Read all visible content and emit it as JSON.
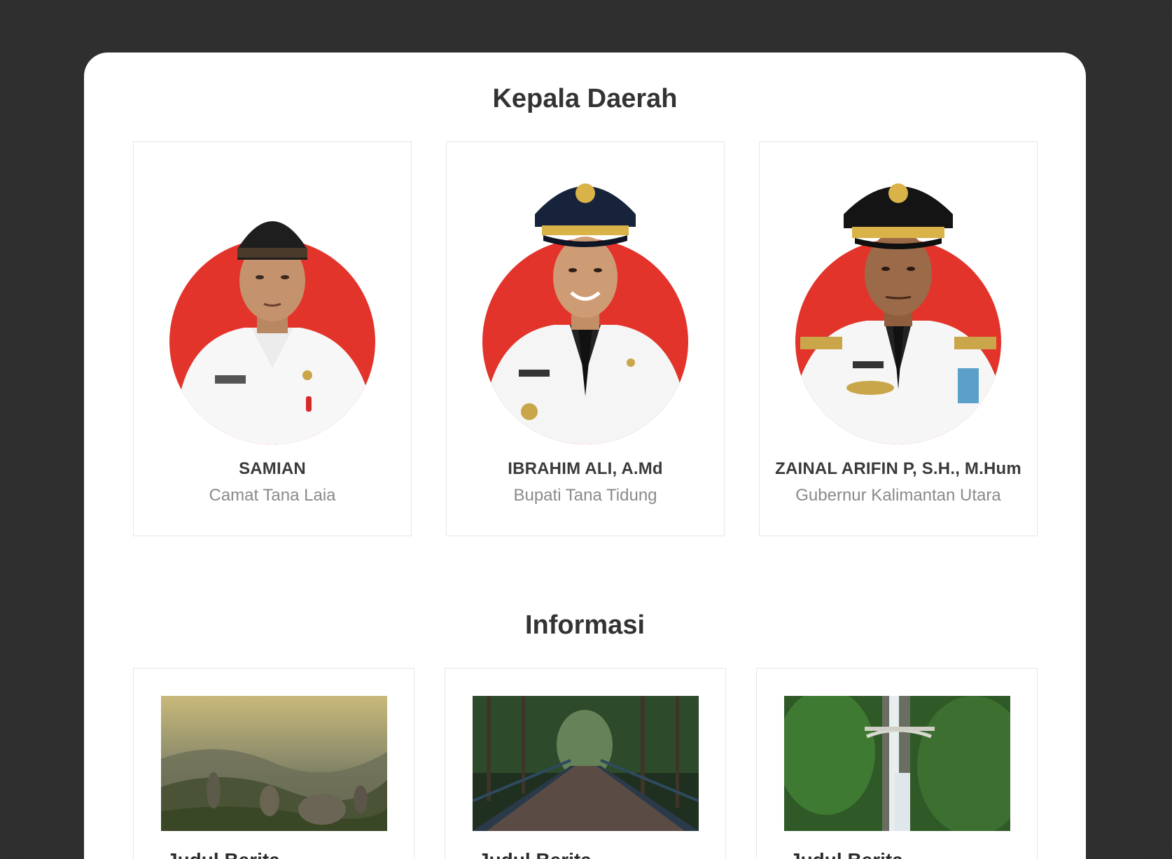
{
  "sections": {
    "leaders_title": "Kepala Daerah",
    "info_title": "Informasi"
  },
  "leaders": [
    {
      "name": "SAMIAN",
      "role": "Camat Tana Laia"
    },
    {
      "name": "IBRAHIM ALI, A.Md",
      "role": "Bupati Tana Tidung"
    },
    {
      "name": "ZAINAL ARIFIN P, S.H., M.Hum",
      "role": "Gubernur Kalimantan Utara"
    }
  ],
  "news": [
    {
      "title": "Judul Berita",
      "image": "mountain-valley-photo"
    },
    {
      "title": "Judul Berita",
      "image": "forest-bridge-photo"
    },
    {
      "title": "Judul Berita",
      "image": "waterfall-bridge-photo"
    }
  ],
  "colors": {
    "accent_red": "#e3342b",
    "frame": "#2f2f2f"
  }
}
